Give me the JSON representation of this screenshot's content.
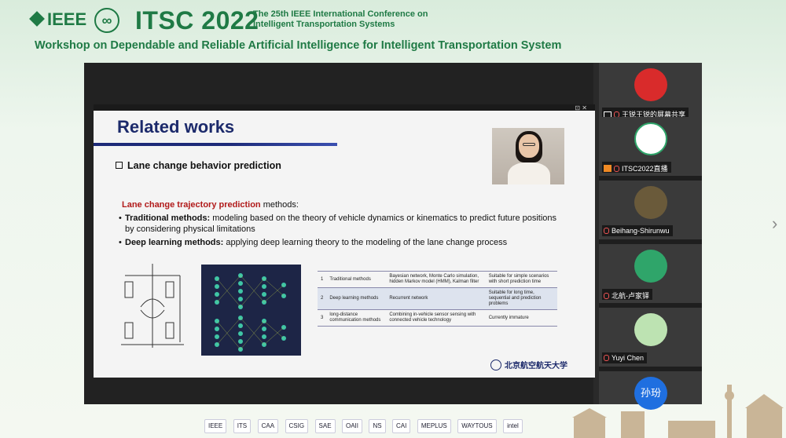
{
  "header": {
    "ieee": "IEEE",
    "its_logo": "∞",
    "conf_title": "ITSC 2022",
    "conf_sub_line1": "The 25th IEEE International Conference on",
    "conf_sub_line2": "Intelligent Transportation Systems",
    "workshop": "Workshop on Dependable and Reliable Artificial Intelligence for Intelligent Transportation System"
  },
  "slide": {
    "title": "Related works",
    "section": "Lane change behavior prediction",
    "lead_red": "Lane change trajectory prediction",
    "lead_rest": " methods:",
    "points": [
      {
        "bold": "Traditional methods:",
        "text": " modeling based on the theory of vehicle dynamics or kinematics to predict future positions by considering physical limitations"
      },
      {
        "bold": "Deep learning methods:",
        "text": " applying deep learning theory to the modeling of the lane change process"
      }
    ],
    "table": [
      {
        "n": "1",
        "method": "Traditional methods",
        "example": "Bayesian network, Monte Carlo simulation, hidden Markov model (HMM), Kalman filter",
        "note": "Suitable for simple scenarios with short prediction time"
      },
      {
        "n": "2",
        "method": "Deep learning methods",
        "example": "Recurrent network",
        "note": "Suitable for long time, sequential and prediction problems"
      },
      {
        "n": "3",
        "method": "long-distance communication methods",
        "example": "Combining in-vehicle sensor sensing with connected vehicle technology",
        "note": "Currently immature"
      }
    ],
    "university_logo": "北京航空航天大学"
  },
  "participants": [
    {
      "name": "王锐王锐的屏幕共享",
      "avatar": "mascot-avatar",
      "color": "#d92b2b"
    },
    {
      "name": "ITSC2022直播",
      "avatar": "its-logo-avatar",
      "color": "#ffffff"
    },
    {
      "name": "Beihang-Shirunwu",
      "avatar": "photo-avatar",
      "color": "#6a5a3a"
    },
    {
      "name": "北航-卢家铎",
      "avatar": "up-arrow-avatar",
      "color": "#2fa56a"
    },
    {
      "name": "Yuyi Chen",
      "avatar": "panda-avatar",
      "color": "#bde3b2"
    },
    {
      "name": "孙玢",
      "avatar": "text-avatar",
      "color": "#1f6fe0"
    }
  ],
  "sponsors": [
    "IEEE",
    "ITS",
    "CAA",
    "CSIG",
    "SAE",
    "OAII",
    "NS",
    "CAI",
    "MEPLUS",
    "WAYTOUS",
    "intel"
  ],
  "nav": {
    "next": "›"
  }
}
